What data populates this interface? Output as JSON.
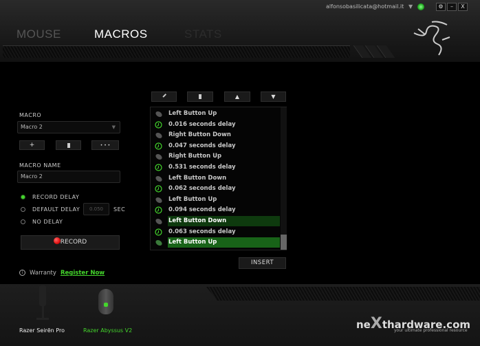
{
  "header": {
    "account": "alfonsobasilicata@hotmail.it",
    "tabs": [
      {
        "label": "MOUSE",
        "state": "inactive"
      },
      {
        "label": "MACROS",
        "state": "active"
      },
      {
        "label": "STATS",
        "state": "disabled"
      }
    ],
    "window_buttons": {
      "settings": "⚙",
      "minimize": "–",
      "close": "X"
    }
  },
  "toolbar": {
    "edit": "edit-icon",
    "delete": "trash-icon",
    "up": "▲",
    "down": "▼"
  },
  "macro": {
    "label": "MACRO",
    "selected": "Macro 2",
    "add": "+",
    "delete": "trash-icon",
    "more": "• • •",
    "name_label": "MACRO NAME",
    "name_value": "Macro 2"
  },
  "delay": {
    "options": [
      {
        "label": "RECORD DELAY",
        "checked": true
      },
      {
        "label": "DEFAULT DELAY",
        "checked": false
      },
      {
        "label": "NO DELAY",
        "checked": false
      }
    ],
    "default_value": "0.050",
    "unit": "SEC"
  },
  "record_label": "RECORD",
  "warranty": {
    "label": "Warranty",
    "link": "Register Now"
  },
  "events": [
    {
      "type": "mouse",
      "text": "Left Button Up"
    },
    {
      "type": "delay",
      "text": "0.016 seconds delay"
    },
    {
      "type": "mouse",
      "text": "Right Button Down"
    },
    {
      "type": "delay",
      "text": "0.047 seconds delay"
    },
    {
      "type": "mouse",
      "text": "Right Button Up"
    },
    {
      "type": "delay",
      "text": "0.531 seconds delay"
    },
    {
      "type": "mouse",
      "text": "Left Button Down"
    },
    {
      "type": "delay",
      "text": "0.062 seconds delay"
    },
    {
      "type": "mouse",
      "text": "Left Button Up"
    },
    {
      "type": "delay",
      "text": "0.094 seconds delay"
    },
    {
      "type": "mouse",
      "text": "Left Button Down",
      "highlight": "selected"
    },
    {
      "type": "delay",
      "text": "0.063 seconds delay"
    },
    {
      "type": "mouse",
      "text": "Left Button Up",
      "highlight": "active"
    }
  ],
  "insert_label": "INSERT",
  "devices": [
    {
      "name": "Razer Seirēn Pro",
      "active": false
    },
    {
      "name": "Razer Abyssus V2",
      "active": true
    }
  ],
  "watermark": {
    "brand": "nexthardware.com",
    "tagline": "your ultimate professional resource"
  },
  "colors": {
    "accent": "#44d62c",
    "record": "#e01010"
  }
}
